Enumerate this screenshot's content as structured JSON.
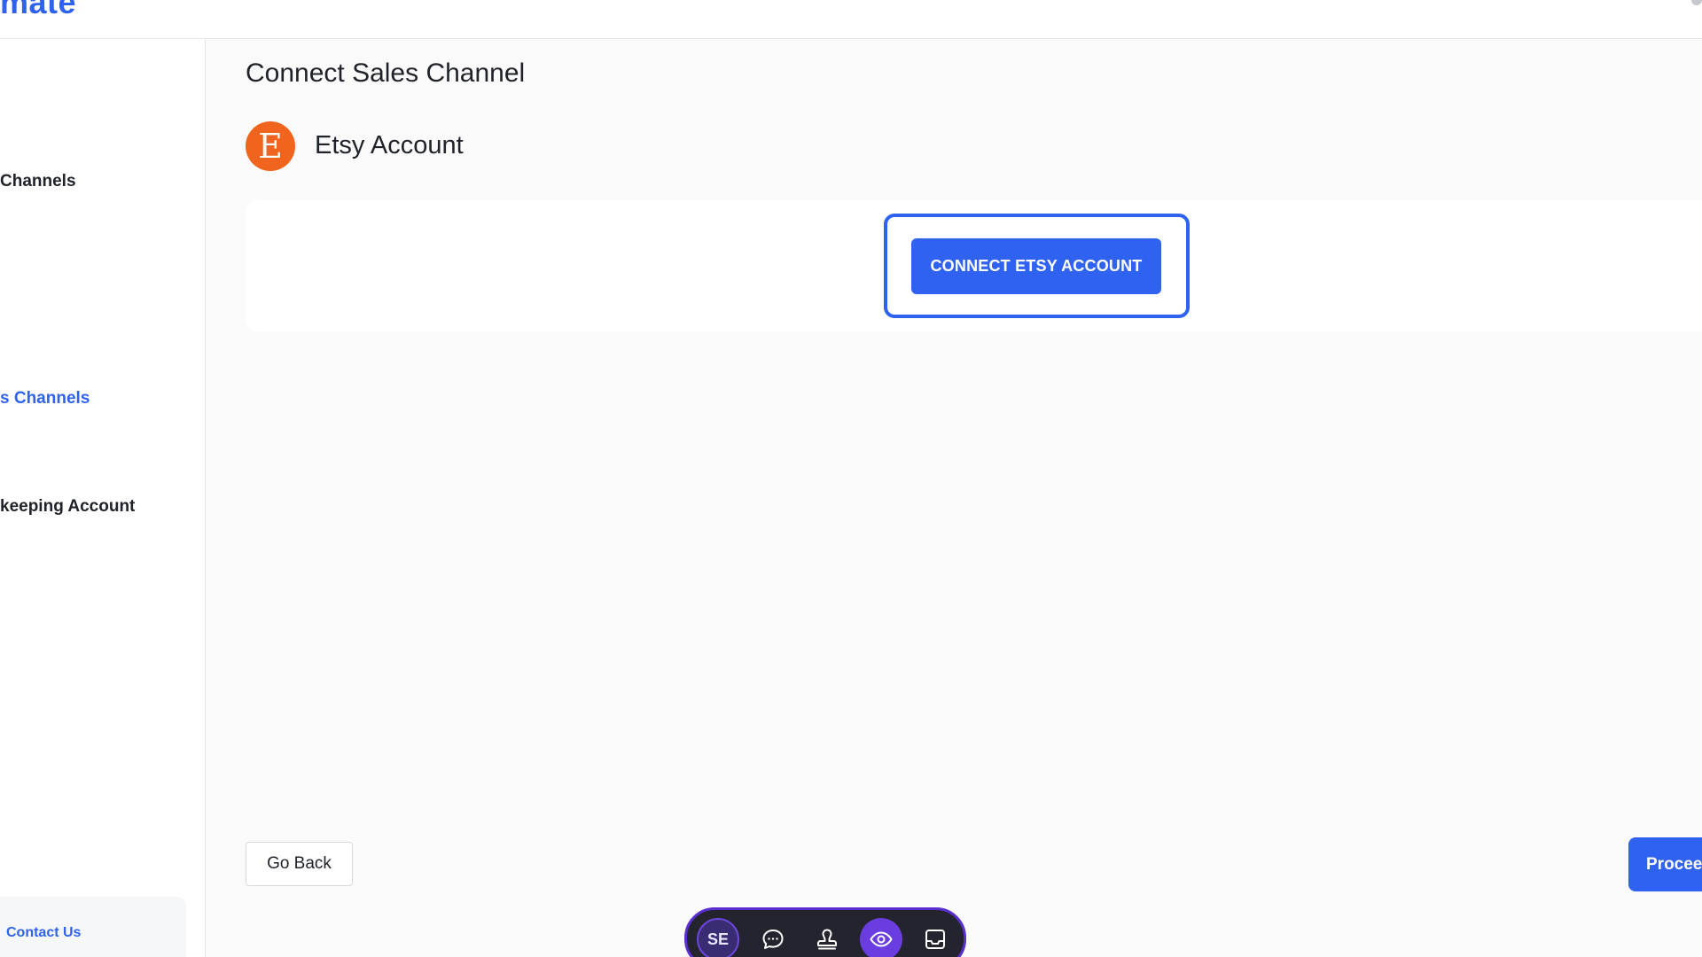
{
  "app": {
    "brand": "mate"
  },
  "sidebar": {
    "items": [
      {
        "label": "Channels",
        "active": false
      },
      {
        "label": "s Channels",
        "active": true
      },
      {
        "label": "keeping Account",
        "active": false
      }
    ],
    "contact_label": "Contact Us"
  },
  "main": {
    "title": "Connect Sales Channel",
    "account_logo_letter": "E",
    "account_label": "Etsy Account",
    "connect_button": "CONNECT ETSY ACCOUNT",
    "go_back_button": "Go Back",
    "proceed_button": "Proceed"
  },
  "toolbar": {
    "avatar_initials": "SE",
    "tools": [
      "chat-bubble-icon",
      "stamp-icon",
      "eye-icon",
      "inbox-icon"
    ]
  },
  "colors": {
    "accent": "#2f62f0",
    "etsy_orange": "#f1641e",
    "toolbar_bg": "#23242d",
    "toolbar_accent": "#6a3de0"
  }
}
